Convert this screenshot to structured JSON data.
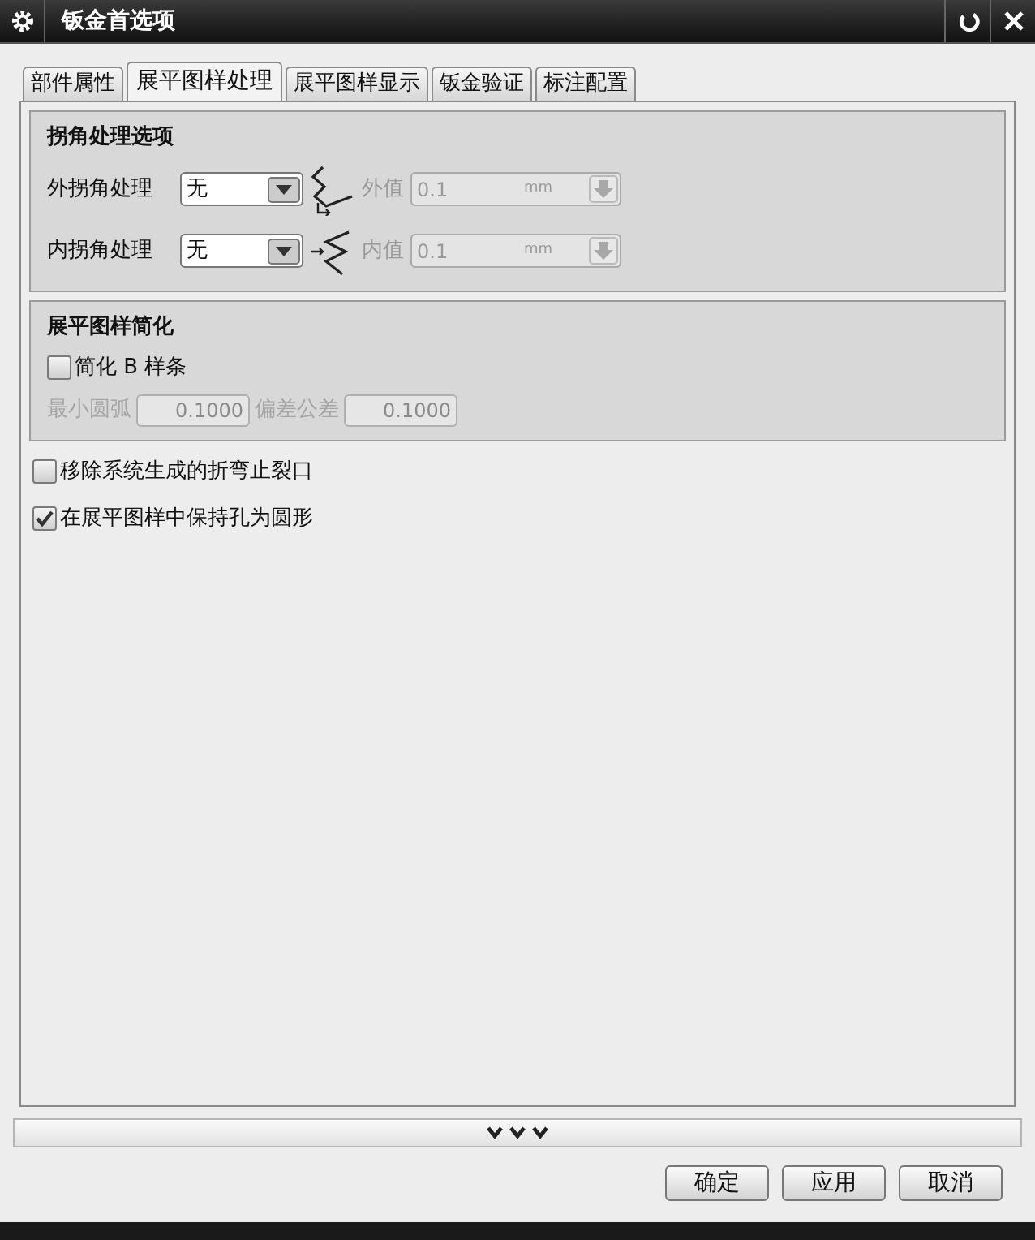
{
  "window": {
    "title": "钣金首选项"
  },
  "tabs": [
    {
      "label": "部件属性",
      "selected": false
    },
    {
      "label": "展平图样处理",
      "selected": true
    },
    {
      "label": "展平图样显示",
      "selected": false
    },
    {
      "label": "钣金验证",
      "selected": false
    },
    {
      "label": "标注配置",
      "selected": false
    }
  ],
  "corner_group": {
    "title": "拐角处理选项",
    "rows": [
      {
        "kind": "outer",
        "label": "外拐角处理",
        "value": "无",
        "field_label": "外值",
        "field_value": "0.1",
        "unit": "mm",
        "disabled": true
      },
      {
        "kind": "inner",
        "label": "内拐角处理",
        "value": "无",
        "field_label": "内值",
        "field_value": "0.1",
        "unit": "mm",
        "disabled": true
      }
    ]
  },
  "simplify_group": {
    "title": "展平图样简化",
    "checkbox": {
      "label": "简化 B 样条",
      "checked": false
    },
    "fields": [
      {
        "label": "最小圆弧",
        "value": "0.1000",
        "disabled": true
      },
      {
        "label": "偏差公差",
        "value": "0.1000",
        "disabled": true
      }
    ]
  },
  "options": [
    {
      "label": "移除系统生成的折弯止裂口",
      "checked": false
    },
    {
      "label": "在展平图样中保持孔为圆形",
      "checked": true
    }
  ],
  "buttons": [
    "确定",
    "应用",
    "取消"
  ]
}
